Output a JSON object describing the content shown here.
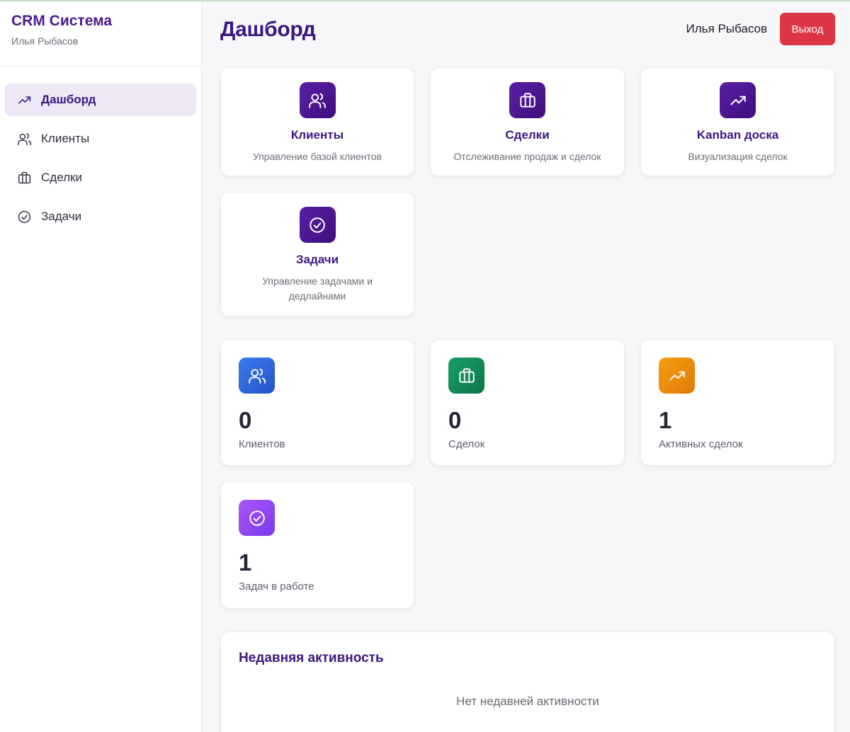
{
  "sidebar": {
    "brand_title": "CRM Система",
    "user_name": "Илья Рыбасов",
    "items": [
      {
        "label": "Дашборд",
        "icon": "trending-up-icon",
        "active": true
      },
      {
        "label": "Клиенты",
        "icon": "users-icon",
        "active": false
      },
      {
        "label": "Сделки",
        "icon": "briefcase-icon",
        "active": false
      },
      {
        "label": "Задачи",
        "icon": "check-circle-icon",
        "active": false
      }
    ]
  },
  "header": {
    "title": "Дашборд",
    "user_name": "Илья Рыбасов",
    "logout_label": "Выход",
    "logout_color": "#dc3545"
  },
  "nav_cards": [
    {
      "title": "Клиенты",
      "description": "Управление базой клиентов",
      "icon": "users-icon"
    },
    {
      "title": "Сделки",
      "description": "Отслеживание продаж и сделок",
      "icon": "briefcase-icon"
    },
    {
      "title": "Kanban доска",
      "description": "Визуализация сделок",
      "icon": "trending-up-icon"
    },
    {
      "title": "Задачи",
      "description": "Управление задачами и дедлайнами",
      "icon": "check-circle-icon"
    }
  ],
  "stats": [
    {
      "value": "0",
      "label": "Клиентов",
      "icon": "users-icon",
      "color": "#2f63d8"
    },
    {
      "value": "0",
      "label": "Сделок",
      "icon": "briefcase-icon",
      "color": "#12875a"
    },
    {
      "value": "1",
      "label": "Активных сделок",
      "icon": "trending-up-icon",
      "color": "#ea8a0c"
    },
    {
      "value": "1",
      "label": "Задач в работе",
      "icon": "check-circle-icon",
      "color": "#8b44e8"
    }
  ],
  "activity": {
    "title": "Недавняя активность",
    "empty_text": "Нет недавней активности"
  },
  "colors": {
    "accent": "#3d1680",
    "active_nav_bg": "#ede7f6"
  }
}
